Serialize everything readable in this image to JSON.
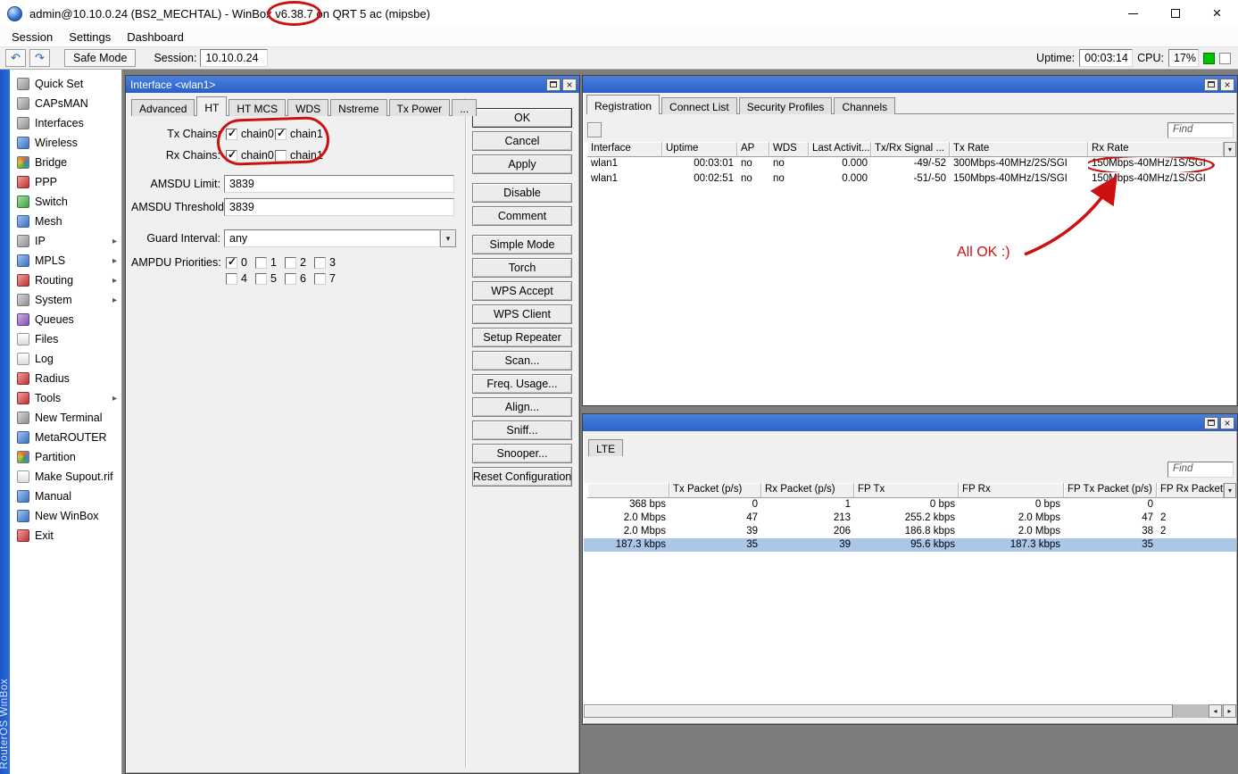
{
  "colors": {
    "annotation_red": "#cc1111",
    "titlebar_blue": "#2b5fc7",
    "selection_blue": "#abc7e8",
    "cpu_indicator_green": "#00c000"
  },
  "titlebar": {
    "title_prefix": "admin@10.10.0.24 (BS2_MECHTAL) - WinBox ",
    "title_version": "v6.38.7",
    "title_suffix": " on QRT 5 ac (mipsbe)"
  },
  "menu": [
    "Session",
    "Settings",
    "Dashboard"
  ],
  "toolbar": {
    "safe_mode": "Safe Mode",
    "session_label": "Session:",
    "session_value": "10.10.0.24",
    "uptime_label": "Uptime:",
    "uptime_value": "00:03:14",
    "cpu_label": "CPU:",
    "cpu_value": "17%"
  },
  "sidebar": {
    "brand": "RouterOS WinBox",
    "items": [
      {
        "label": "Quick Set",
        "icon": "quick-set-icon",
        "submenu": false
      },
      {
        "label": "CAPsMAN",
        "icon": "capsman-icon",
        "submenu": false
      },
      {
        "label": "Interfaces",
        "icon": "interfaces-icon",
        "submenu": false
      },
      {
        "label": "Wireless",
        "icon": "wireless-icon",
        "submenu": false
      },
      {
        "label": "Bridge",
        "icon": "bridge-icon",
        "submenu": false
      },
      {
        "label": "PPP",
        "icon": "ppp-icon",
        "submenu": false
      },
      {
        "label": "Switch",
        "icon": "switch-icon",
        "submenu": false
      },
      {
        "label": "Mesh",
        "icon": "mesh-icon",
        "submenu": false
      },
      {
        "label": "IP",
        "icon": "ip-icon",
        "submenu": true
      },
      {
        "label": "MPLS",
        "icon": "mpls-icon",
        "submenu": true
      },
      {
        "label": "Routing",
        "icon": "routing-icon",
        "submenu": true
      },
      {
        "label": "System",
        "icon": "system-icon",
        "submenu": true
      },
      {
        "label": "Queues",
        "icon": "queues-icon",
        "submenu": false
      },
      {
        "label": "Files",
        "icon": "files-icon",
        "submenu": false
      },
      {
        "label": "Log",
        "icon": "log-icon",
        "submenu": false
      },
      {
        "label": "Radius",
        "icon": "radius-icon",
        "submenu": false
      },
      {
        "label": "Tools",
        "icon": "tools-icon",
        "submenu": true
      },
      {
        "label": "New Terminal",
        "icon": "terminal-icon",
        "submenu": false
      },
      {
        "label": "MetaROUTER",
        "icon": "metarouter-icon",
        "submenu": false
      },
      {
        "label": "Partition",
        "icon": "partition-icon",
        "submenu": false
      },
      {
        "label": "Make Supout.rif",
        "icon": "supout-icon",
        "submenu": false
      },
      {
        "label": "Manual",
        "icon": "manual-icon",
        "submenu": false
      },
      {
        "label": "New WinBox",
        "icon": "new-winbox-icon",
        "submenu": false
      },
      {
        "label": "Exit",
        "icon": "exit-icon",
        "submenu": false
      }
    ]
  },
  "dialog": {
    "title": "Interface <wlan1>",
    "tabs": [
      "Advanced",
      "HT",
      "HT MCS",
      "WDS",
      "Nstreme",
      "Tx Power",
      "..."
    ],
    "active_tab": "HT",
    "fields": {
      "tx_chains_label": "Tx Chains:",
      "rx_chains_label": "Rx Chains:",
      "chain0_label": "chain0",
      "chain1_label": "chain1",
      "tx_chains": {
        "chain0": true,
        "chain1": true
      },
      "rx_chains": {
        "chain0": true,
        "chain1": false
      },
      "amsdu_limit_label": "AMSDU Limit:",
      "amsdu_limit_value": "3839",
      "amsdu_threshold_label": "AMSDU Threshold:",
      "amsdu_threshold_value": "3839",
      "guard_interval_label": "Guard Interval:",
      "guard_interval_value": "any",
      "ampdu_label": "AMPDU Priorities:",
      "ampdu_options": [
        "0",
        "1",
        "2",
        "3",
        "4",
        "5",
        "6",
        "7"
      ],
      "ampdu_checked": [
        true,
        false,
        false,
        false,
        false,
        false,
        false,
        false
      ]
    },
    "buttons": [
      "OK",
      "Cancel",
      "Apply",
      "Disable",
      "Comment",
      "Simple Mode",
      "Torch",
      "WPS Accept",
      "WPS Client",
      "Setup Repeater",
      "Scan...",
      "Freq. Usage...",
      "Align...",
      "Sniff...",
      "Snooper...",
      "Reset Configuration"
    ]
  },
  "registration": {
    "tabs": [
      "Registration",
      "Connect List",
      "Security Profiles",
      "Channels"
    ],
    "active_tab": "Registration",
    "find_label": "Find",
    "columns": [
      "Interface",
      "Uptime",
      "AP",
      "WDS",
      "Last Activit...",
      "Tx/Rx Signal ...",
      "Tx Rate",
      "Rx Rate"
    ],
    "rows": [
      [
        "wlan1",
        "00:03:01",
        "no",
        "no",
        "0.000",
        "-49/-52",
        "300Mbps-40MHz/2S/SGI",
        "150Mbps-40MHz/1S/SGI"
      ],
      [
        "wlan1",
        "00:02:51",
        "no",
        "no",
        "0.000",
        "-51/-50",
        "150Mbps-40MHz/1S/SGI",
        "150Mbps-40MHz/1S/SGI"
      ]
    ]
  },
  "lte": {
    "tab": "LTE",
    "find_label": "Find",
    "columns": [
      "",
      "Tx Packet (p/s)",
      "Rx Packet (p/s)",
      "FP Tx",
      "FP Rx",
      "FP Tx Packet (p/s)",
      "FP Rx Packet"
    ],
    "rows": [
      [
        "368 bps",
        "0",
        "1",
        "0 bps",
        "0 bps",
        "0",
        ""
      ],
      [
        "2.0 Mbps",
        "47",
        "213",
        "255.2 kbps",
        "2.0 Mbps",
        "47",
        "2"
      ],
      [
        "2.0 Mbps",
        "39",
        "206",
        "186.8 kbps",
        "2.0 Mbps",
        "38",
        "2"
      ],
      [
        "187.3 kbps",
        "35",
        "39",
        "95.6 kbps",
        "187.3 kbps",
        "35",
        ""
      ]
    ],
    "selected_row_index": 3
  },
  "annotations": {
    "all_ok_text": "All OK :)"
  }
}
